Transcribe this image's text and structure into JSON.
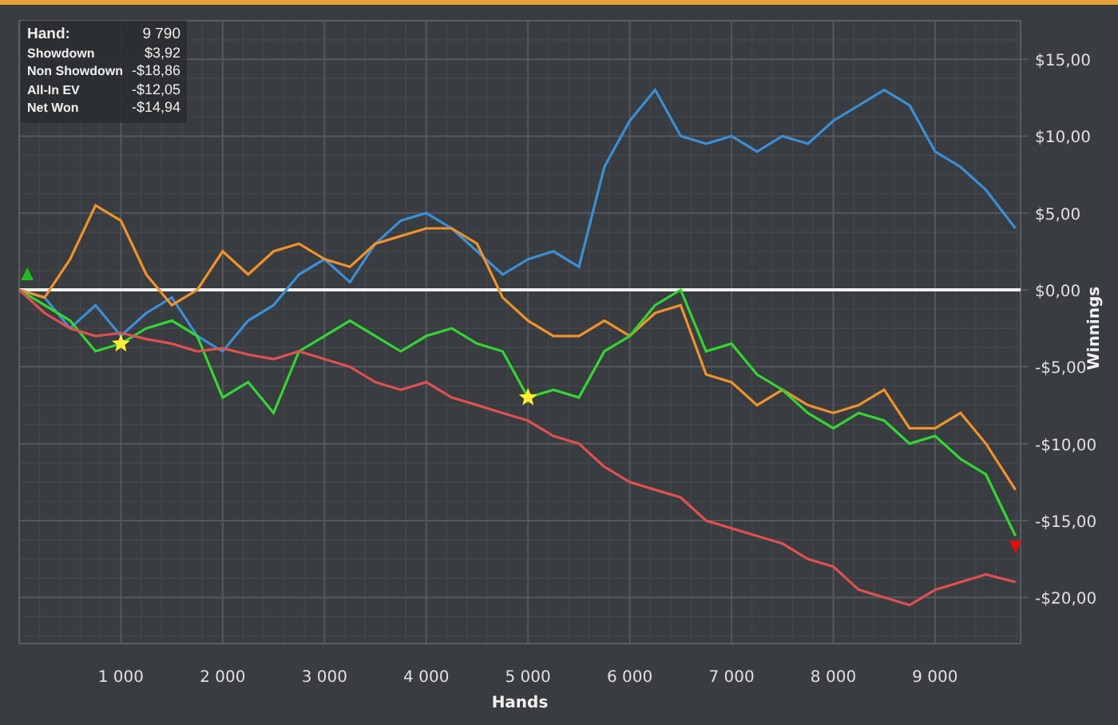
{
  "stats": [
    {
      "label": "Hand:",
      "value": "9 790"
    },
    {
      "label": "Showdown",
      "value": "$3,92"
    },
    {
      "label": "Non Showdown",
      "value": "-$18,86"
    },
    {
      "label": "All-In EV",
      "value": "-$12,05"
    },
    {
      "label": "Net Won",
      "value": "-$14,94"
    }
  ],
  "chart_data": {
    "type": "line",
    "xlabel": "Hands",
    "ylabel": "Winnings",
    "x": [
      0,
      250,
      500,
      750,
      1000,
      1250,
      1500,
      1750,
      2000,
      2250,
      2500,
      2750,
      3000,
      3250,
      3500,
      3750,
      4000,
      4250,
      4500,
      4750,
      5000,
      5250,
      5500,
      5750,
      6000,
      6250,
      6500,
      6750,
      7000,
      7250,
      7500,
      7750,
      8000,
      8250,
      8500,
      8750,
      9000,
      9250,
      9500,
      9790
    ],
    "series": [
      {
        "color": "#3b8fd6",
        "values": [
          0,
          -0.5,
          -2.5,
          -1,
          -3,
          -1.5,
          -0.5,
          -3,
          -4,
          -2,
          -1,
          1,
          2,
          0.5,
          3,
          4.5,
          5,
          4,
          2.5,
          1,
          2,
          2.5,
          1.5,
          8,
          11,
          13,
          10,
          9.5,
          10,
          9,
          10,
          9.5,
          11,
          12,
          13,
          12,
          9,
          8,
          6.5,
          4
        ]
      },
      {
        "color": "#f0922b",
        "values": [
          0,
          -0.5,
          2,
          5.5,
          4.5,
          1,
          -1,
          0,
          2.5,
          1,
          2.5,
          3,
          2,
          1.5,
          3,
          3.5,
          4,
          4,
          3,
          -0.5,
          -2,
          -3,
          -3,
          -2,
          -3,
          -1.5,
          -1,
          -5.5,
          -6,
          -7.5,
          -6.5,
          -7.5,
          -8,
          -7.5,
          -6.5,
          -9,
          -9,
          -8,
          -10,
          -13
        ]
      },
      {
        "color": "#33d633",
        "values": [
          0,
          -1,
          -2,
          -4,
          -3.5,
          -2.5,
          -2,
          -3,
          -7,
          -6,
          -8,
          -4,
          -3,
          -2,
          -3,
          -4,
          -3,
          -2.5,
          -3.5,
          -4,
          -7,
          -6.5,
          -7,
          -4,
          -3,
          -1,
          0,
          -4,
          -3.5,
          -5.5,
          -6.5,
          -8,
          -9,
          -8,
          -8.5,
          -10,
          -9.5,
          -11,
          -12,
          -16
        ]
      },
      {
        "color": "#e05050",
        "values": [
          0,
          -1.5,
          -2.5,
          -3,
          -2.8,
          -3.2,
          -3.5,
          -4,
          -3.8,
          -4.2,
          -4.5,
          -4,
          -4.5,
          -5,
          -6,
          -6.5,
          -6,
          -7,
          -7.5,
          -8,
          -8.5,
          -9.5,
          -10,
          -11.5,
          -12.5,
          -13,
          -13.5,
          -15,
          -15.5,
          -16,
          -16.5,
          -17.5,
          -18,
          -19.5,
          -20,
          -20.5,
          -19.5,
          -19,
          -18.5,
          -19
        ]
      }
    ],
    "xlim": [
      0,
      9840
    ],
    "grid": true,
    "ylim": [
      -23,
      17.5
    ],
    "xticks": [
      {
        "value": 1000,
        "label": "1 000"
      },
      {
        "value": 2000,
        "label": "2 000"
      },
      {
        "value": 3000,
        "label": "3 000"
      },
      {
        "value": 4000,
        "label": "4 000"
      },
      {
        "value": 5000,
        "label": "5 000"
      },
      {
        "value": 6000,
        "label": "6 000"
      },
      {
        "value": 7000,
        "label": "7 000"
      },
      {
        "value": 8000,
        "label": "8 000"
      },
      {
        "value": 9000,
        "label": "9 000"
      }
    ],
    "yticks": [
      {
        "value": 15,
        "label": "$15,00"
      },
      {
        "value": 10,
        "label": "$10,00"
      },
      {
        "value": 5,
        "label": "$5,00"
      },
      {
        "value": 0,
        "label": "$0,00"
      },
      {
        "value": -5,
        "label": "-$5,00"
      },
      {
        "value": -10,
        "label": "-$10,00"
      },
      {
        "value": -15,
        "label": "-$15,00"
      },
      {
        "value": -20,
        "label": "-$20,00"
      }
    ]
  }
}
